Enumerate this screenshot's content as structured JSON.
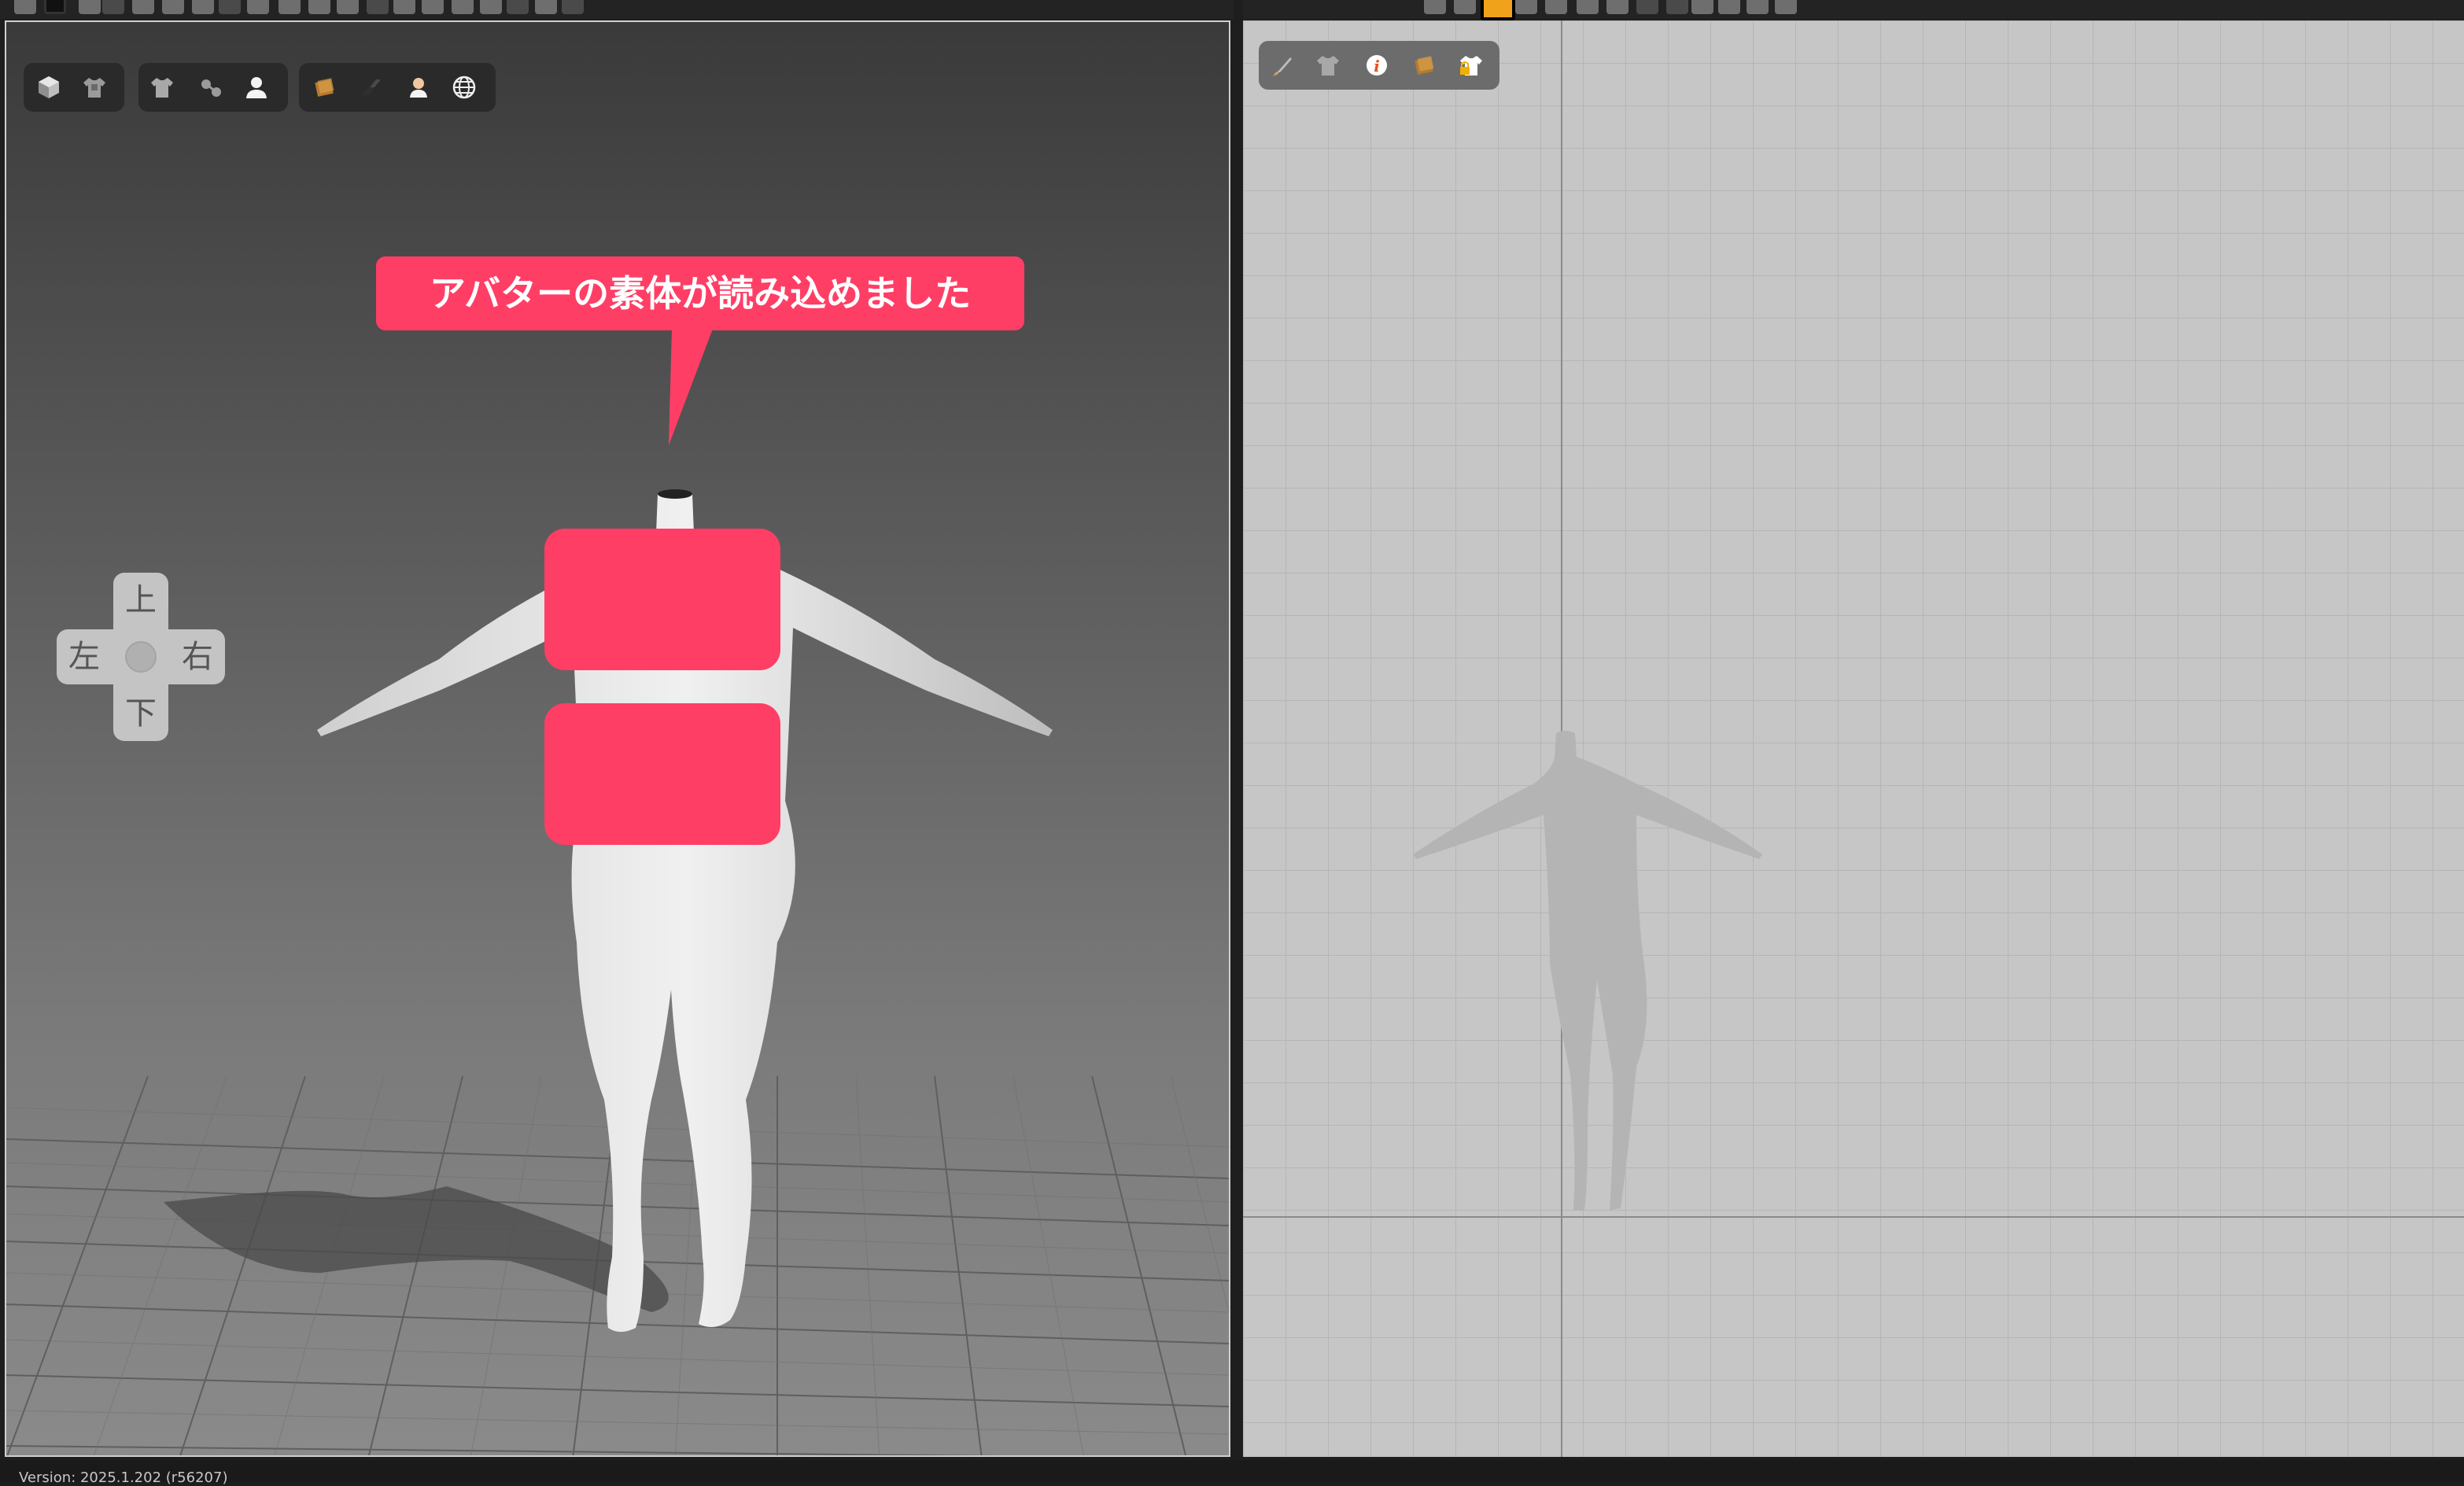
{
  "viewport_3d": {
    "nav_pad": {
      "up": "上",
      "down": "下",
      "left": "左",
      "right": "右"
    },
    "notification": "アバターの素体が読み込めました",
    "toolbar_groups": [
      {
        "group": "display-mode",
        "icons": [
          "cube-icon",
          "garment-texture-icon"
        ]
      },
      {
        "group": "garment-avatar",
        "icons": [
          "shirt-icon",
          "pins-icon",
          "avatar-icon"
        ]
      },
      {
        "group": "render",
        "icons": [
          "texture-icon",
          "shadow-icon",
          "skin-icon",
          "globe-icon"
        ]
      }
    ]
  },
  "viewport_2d": {
    "toolbar_icons": [
      "brush-icon",
      "shirt-icon",
      "info-icon",
      "texture-icon",
      "lock-shirt-icon"
    ]
  },
  "status_bar": {
    "version": "Version: 2025.1.202 (r56207)"
  },
  "colors": {
    "accent": "#ff3e66",
    "active_tool": "#f0a21a",
    "info": "#e6501e"
  }
}
